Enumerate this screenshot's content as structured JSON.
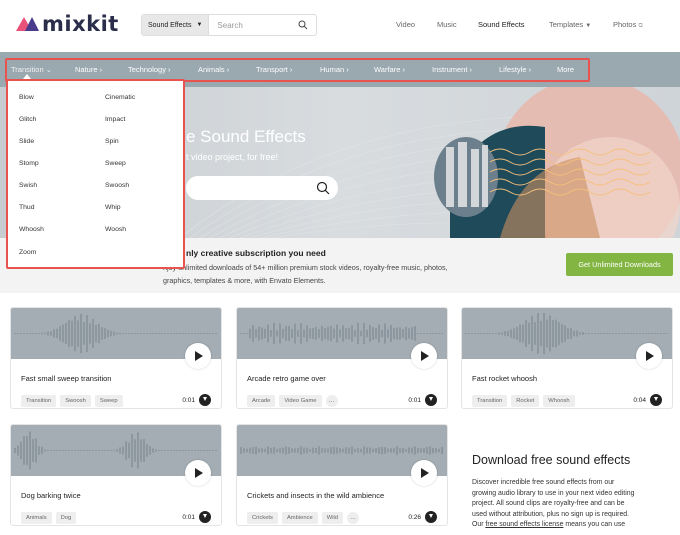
{
  "header": {
    "logo_text": "mixkit",
    "search": {
      "category": "Sound Effects",
      "placeholder": "Search"
    },
    "nav": [
      "Video",
      "Music",
      "Sound Effects",
      "Templates",
      "Photos"
    ]
  },
  "categories": [
    "Transition",
    "Nature",
    "Technology",
    "Animals",
    "Transport",
    "Human",
    "Warfare",
    "Instrument",
    "Lifestyle",
    "More"
  ],
  "dropdown": {
    "left": [
      "Blow",
      "Glitch",
      "Slide",
      "Stomp",
      "Swish",
      "Thud",
      "Whoosh",
      "Zoom"
    ],
    "right": [
      "Cinematic",
      "Impact",
      "Spin",
      "Sweep",
      "Swoosh",
      "Whip",
      "Woosh"
    ]
  },
  "hero": {
    "title": "e Sound Effects",
    "subtitle": "t video project, for free!"
  },
  "envato": {
    "title": "nly creative subscription you need",
    "line1": "njoy unlimited downloads of 54+ million premium stock videos, royalty-free music, photos,",
    "line2": "graphics, templates & more, with Envato Elements.",
    "button": "Get Unlimited Downloads"
  },
  "cards": [
    {
      "title": "Fast small sweep transition",
      "tags": [
        "Transition",
        "Swoosh",
        "Sweep"
      ],
      "more": false,
      "duration": "0:01"
    },
    {
      "title": "Arcade retro game over",
      "tags": [
        "Arcade",
        "Video Game"
      ],
      "more": true,
      "duration": "0:01"
    },
    {
      "title": "Fast rocket whoosh",
      "tags": [
        "Transition",
        "Rocket",
        "Whoosh"
      ],
      "more": false,
      "duration": "0:04"
    },
    {
      "title": "Dog barking twice",
      "tags": [
        "Animals",
        "Dog"
      ],
      "more": false,
      "duration": "0:01"
    },
    {
      "title": "Crickets and insects in the wild ambience",
      "tags": [
        "Crickets",
        "Ambience",
        "Wild"
      ],
      "more": true,
      "duration": "0:26"
    }
  ],
  "download_section": {
    "title": "Download free sound effects",
    "para_lines": [
      "Discover incredible free sound effects from our",
      "growing audio library to use in your next video editing",
      "project. All sound clips are royalty-free and can be",
      "used without attribution, plus no sign up is required."
    ],
    "last_prefix": "Our ",
    "last_link": "free sound effects license",
    "last_suffix": " means you can use"
  },
  "more_icon": "…",
  "colors": {
    "accent_red": "#e8524f",
    "nav_bar": "#9aa8b0",
    "green_button": "#82b541",
    "logo_pink": "#e8527a",
    "logo_purple": "#4a3a8c"
  }
}
